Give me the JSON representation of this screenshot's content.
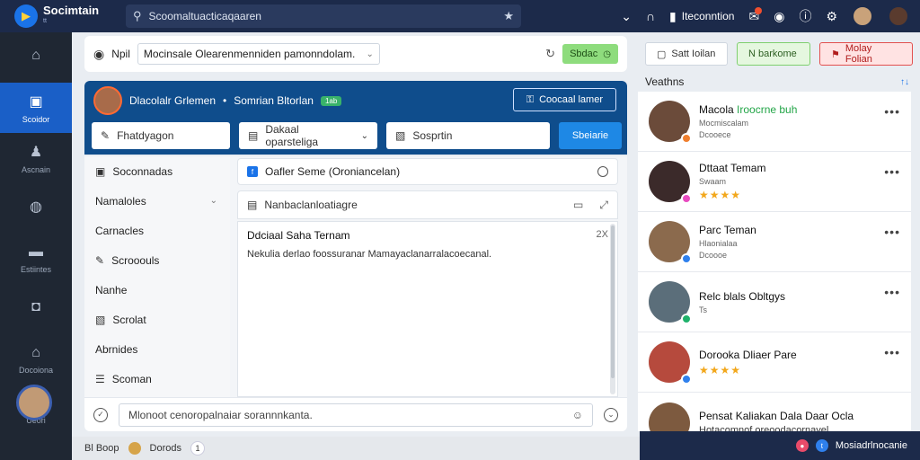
{
  "topbar": {
    "app_name": "Socimtain",
    "app_sub": "tt",
    "search_text": "Scoomaltuacticaqaaren",
    "user_name": "Iteconntion"
  },
  "sidebar": {
    "items": [
      {
        "label": "",
        "icon": "home-icon",
        "glyph": "⌂"
      },
      {
        "label": "Scoidor",
        "icon": "book-icon",
        "glyph": "▣",
        "active": true
      },
      {
        "label": "Ascnain",
        "icon": "people-icon",
        "glyph": "♟"
      },
      {
        "label": "",
        "icon": "compass-icon",
        "glyph": "◍"
      },
      {
        "label": "Estiintes",
        "icon": "briefcase-icon",
        "glyph": "▬"
      },
      {
        "label": "",
        "icon": "gamepad-icon",
        "glyph": "◘"
      },
      {
        "label": "Docoiona",
        "icon": "house-outline-icon",
        "glyph": "⌂"
      },
      {
        "label": "Ueori",
        "icon": "camera-icon",
        "glyph": "◙"
      }
    ]
  },
  "filterbar": {
    "label": "Npil",
    "select_value": "Mocinsale Olearenmenniden pamonndolam.",
    "save_label": "Sbdac"
  },
  "banner": {
    "title": "Dlacolalr Grlemen",
    "subtitle": "Somrian Bltorlan",
    "tag": "1ab",
    "button_label": "Coocaal lamer",
    "field1": "Fhatdyagon",
    "field2": "Dakaal oparsteliga",
    "field3": "Sosprtin",
    "search_label": "Sbeiarie"
  },
  "nav": {
    "items": [
      {
        "label": "Soconnadas",
        "type": "header"
      },
      {
        "label": "Namaloles",
        "type": "group"
      },
      {
        "label": "Carnacles",
        "type": "item"
      },
      {
        "label": "Scrooouls",
        "type": "sub"
      },
      {
        "label": "Nanhe",
        "type": "item"
      },
      {
        "label": "Scrolat",
        "type": "sub"
      },
      {
        "label": "Abrnides",
        "type": "item"
      },
      {
        "label": "Scoman",
        "type": "sub"
      }
    ]
  },
  "content": {
    "status_text": "Oafler Seme (Oroniancelan)",
    "doc_title": "Nanbaclanloatiagre",
    "message_title": "Ddciaal Saha Ternam",
    "message_close": "2X",
    "message_body": "Nekulia derlao foossuranar Mamayaclanarralacoecanal."
  },
  "compose": {
    "placeholder": "Mlonoot cenoropalnaiar sorannnkanta."
  },
  "statusbar": {
    "left": "Bl Boop",
    "middle": "Dorods",
    "count": "1"
  },
  "right": {
    "btn_a": "Satt Ioilan",
    "btn_b": "N barkome",
    "btn_c": "Molay Folian",
    "heading": "Veathns",
    "sort_icon": "↑↓",
    "contacts": [
      {
        "name": "Macola",
        "extra": "Iroocrne buh",
        "sub": "Mocmiscalam",
        "meta": "Dcooece",
        "stars": "",
        "color": "#6b4b3a",
        "badge": "#f07f2e"
      },
      {
        "name": "Dttaat Temam",
        "extra": "",
        "sub": "Swaam",
        "meta": "",
        "stars": "★★★★",
        "color": "#3b2a2a",
        "badge": "#e94bc0"
      },
      {
        "name": "Parc Teman",
        "extra": "",
        "sub": "Hlaonialaa",
        "meta": "Dcoooe",
        "stars": "",
        "color": "#8b6a4d",
        "badge": "#2f80ed"
      },
      {
        "name": "Relc blals Obltgys",
        "extra": "",
        "sub": "Ts",
        "meta": "",
        "stars": "",
        "color": "#5b6e7a",
        "badge": "#1fb26b"
      },
      {
        "name": "Dorooka Dliaer Pare",
        "extra": "",
        "sub": "",
        "meta": "",
        "stars": "★★★★",
        "color": "#b64a3d",
        "badge": "#2f80ed"
      },
      {
        "name": "Pensat Kaliakan Dala Daar Ocla",
        "extra": "",
        "sub": "Hotacomnof oreoodacornayel",
        "meta": "",
        "stars": "",
        "color": "#7d5a3f",
        "badge": "#1f9d64"
      }
    ],
    "footer_label": "Mosiadrlnocanie"
  }
}
